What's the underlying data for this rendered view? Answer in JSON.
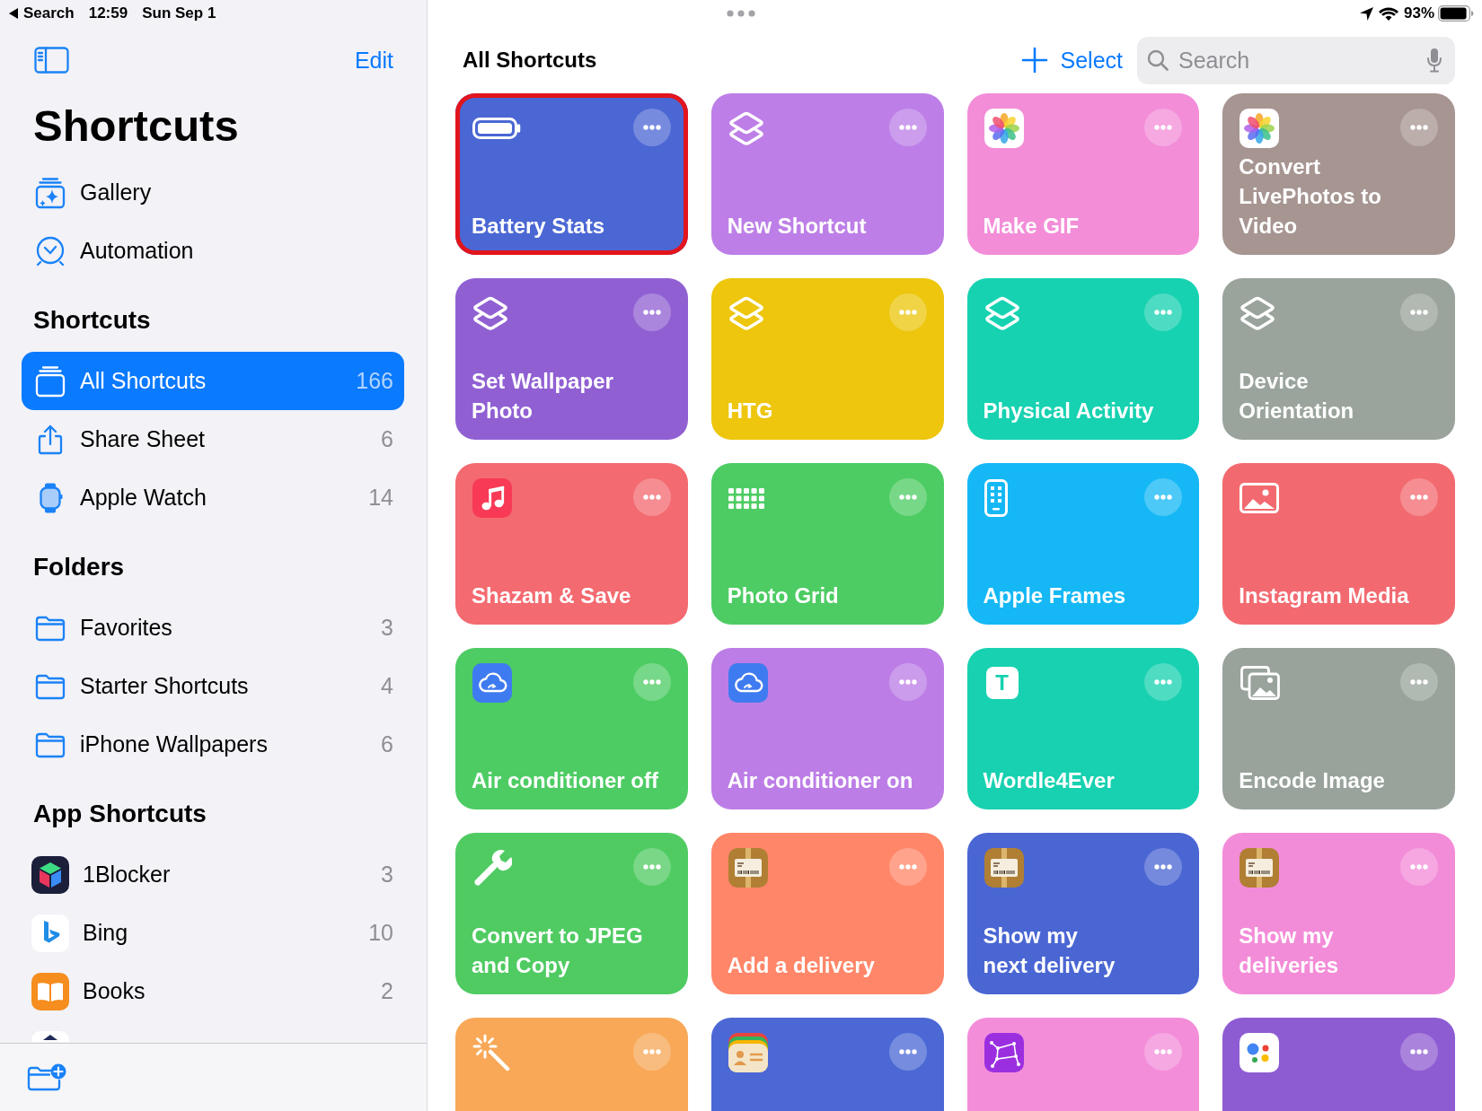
{
  "status_bar": {
    "back_label": "Search",
    "time": "12:59",
    "date": "Sun Sep 1",
    "battery": "93%"
  },
  "sidebar": {
    "edit": "Edit",
    "title": "Shortcuts",
    "sections": [
      {
        "items": [
          {
            "label": "Gallery",
            "kind": "gallery",
            "selected": false
          },
          {
            "label": "Automation",
            "kind": "automation",
            "selected": false
          }
        ]
      },
      {
        "heading": "Shortcuts",
        "items": [
          {
            "label": "All Shortcuts",
            "count": "166",
            "kind": "stack",
            "selected": true
          },
          {
            "label": "Share Sheet",
            "count": "6",
            "kind": "share",
            "selected": false
          },
          {
            "label": "Apple Watch",
            "count": "14",
            "kind": "watch",
            "selected": false
          }
        ]
      },
      {
        "heading": "Folders",
        "items": [
          {
            "label": "Favorites",
            "count": "3",
            "kind": "folder",
            "selected": false
          },
          {
            "label": "Starter Shortcuts",
            "count": "4",
            "kind": "folder",
            "selected": false
          },
          {
            "label": "iPhone Wallpapers",
            "count": "6",
            "kind": "folder",
            "selected": false
          }
        ]
      },
      {
        "heading": "App Shortcuts",
        "items": [
          {
            "label": "1Blocker",
            "count": "3",
            "kind": "cube",
            "selected": false
          },
          {
            "label": "Bing",
            "count": "10",
            "kind": "swoosh",
            "selected": false
          },
          {
            "label": "Books",
            "count": "2",
            "kind": "book",
            "selected": false
          },
          {
            "kind": "partial",
            "selected": false
          }
        ]
      }
    ]
  },
  "main": {
    "title": "All Shortcuts",
    "select": "Select",
    "search": {
      "placeholder": "Search"
    },
    "shortcuts": [
      {
        "title": "Battery Stats",
        "color": "#4b67d4",
        "kind": "battery",
        "highlighted": true
      },
      {
        "title": "New Shortcut",
        "color": "#bd7fe7",
        "kind": "layers",
        "highlighted": false
      },
      {
        "title": "Make GIF",
        "color": "#f38dd8",
        "kind": "flower",
        "highlighted": false
      },
      {
        "title": "Convert\nLivePhotos to\nVideo",
        "color": "#a69591",
        "kind": "flower",
        "highlighted": false
      },
      {
        "title": "Set Wallpaper\nPhoto",
        "color": "#9060d3",
        "kind": "layers",
        "highlighted": false
      },
      {
        "title": "HTG",
        "color": "#edc60d",
        "kind": "layers",
        "highlighted": false
      },
      {
        "title": "Physical Activity",
        "color": "#16d2b1",
        "kind": "layers",
        "highlighted": false
      },
      {
        "title": "Device\nOrientation",
        "color": "#9aa49c",
        "kind": "layers",
        "highlighted": false
      },
      {
        "title": "Shazam & Save",
        "color": "#f36a70",
        "kind": "note",
        "highlighted": false
      },
      {
        "title": "Photo Grid",
        "color": "#4dcc63",
        "kind": "grid",
        "highlighted": false
      },
      {
        "title": "Apple Frames",
        "color": "#15b8f5",
        "kind": "phone",
        "highlighted": false
      },
      {
        "title": "Instagram Media",
        "color": "#f26a70",
        "kind": "image",
        "highlighted": false
      },
      {
        "title": "Air conditioner off",
        "color": "#4ecc64",
        "kind": "cloud",
        "highlighted": false
      },
      {
        "title": "Air conditioner on",
        "color": "#bc7ee6",
        "kind": "cloud",
        "highlighted": false
      },
      {
        "title": "Wordle4Ever",
        "color": "#17d1b0",
        "kind": "letter",
        "icon_text": "T",
        "highlighted": false
      },
      {
        "title": "Encode Image",
        "color": "#99a39b",
        "kind": "images",
        "highlighted": false
      },
      {
        "title": "Convert to JPEG\nand Copy",
        "color": "#4fcb62",
        "kind": "wrench",
        "highlighted": false
      },
      {
        "title": "Add a delivery",
        "color": "#ff8668",
        "kind": "parcel",
        "highlighted": false
      },
      {
        "title": "Show my\nnext delivery",
        "color": "#4a66d3",
        "kind": "parcel",
        "highlighted": false
      },
      {
        "title": "Show my\ndeliveries",
        "color": "#f38cd8",
        "kind": "parcel",
        "highlighted": false
      },
      {
        "color": "#f8a857",
        "kind": "wand",
        "highlighted": false
      },
      {
        "color": "#4c68d5",
        "kind": "card",
        "highlighted": false
      },
      {
        "color": "#f48dd9",
        "kind": "constellation",
        "highlighted": false
      },
      {
        "color": "#8e5cd2",
        "kind": "dots",
        "highlighted": false
      }
    ]
  }
}
